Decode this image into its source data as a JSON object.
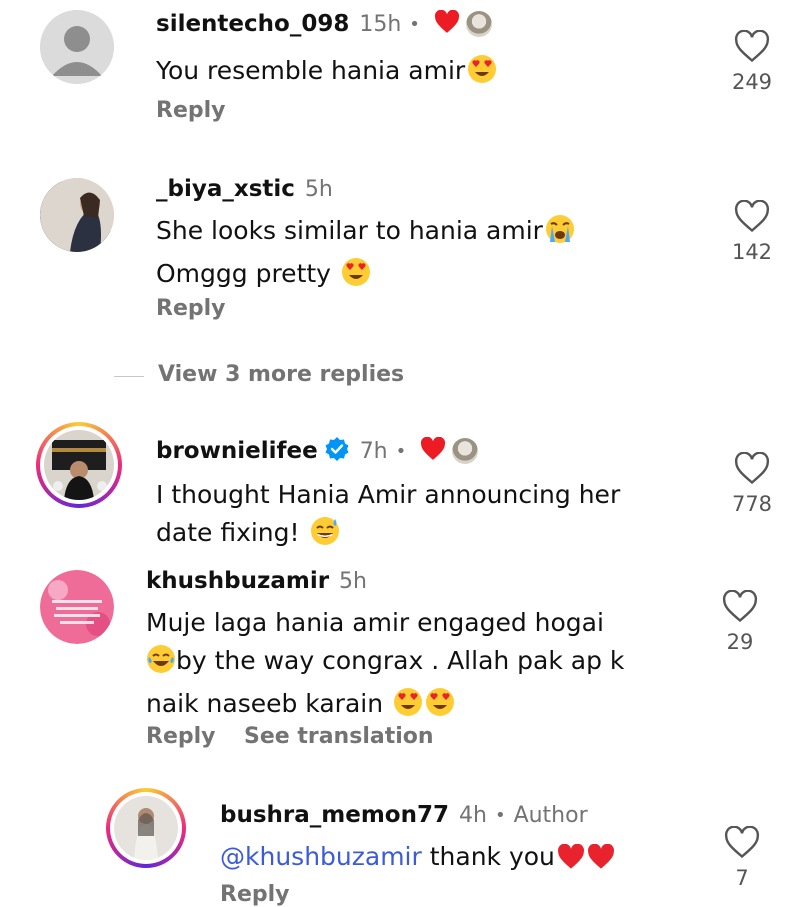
{
  "comments": [
    {
      "username": "silentecho_098",
      "time": "15h",
      "text_lines": [
        "You resemble hania amir"
      ],
      "reply": "Reply",
      "likes": "249",
      "creator_liked": true
    },
    {
      "username": "_biya_xstic",
      "time": "5h",
      "text_lines": [
        "She looks similar to hania amir",
        "Omggg pretty"
      ],
      "reply": "Reply",
      "likes": "142"
    },
    {
      "username": "brownielifee",
      "time": "7h",
      "text_lines": [
        "I thought Hania Amir announcing her",
        "date fixing!"
      ],
      "likes": "778",
      "verified": true,
      "creator_liked": true
    },
    {
      "username": "khushbuzamir",
      "time": "5h",
      "text_lines": [
        "Muje laga hania amir engaged hogai",
        "by the way congrax . Allah pak ap k",
        "naik naseeb karain"
      ],
      "reply": "Reply",
      "see_translation": "See translation",
      "likes": "29"
    },
    {
      "username": "bushra_memon77",
      "time": "4h",
      "badge": "Author",
      "mention": "@khushbuzamir",
      "text": " thank you",
      "reply": "Reply",
      "likes": "7"
    }
  ],
  "view_more": "View 3 more replies",
  "separator": "•",
  "icons": {
    "like": "heart-outline-icon",
    "creator_like": "red-heart-icon",
    "verified": "verified-badge-icon"
  },
  "colors": {
    "heart_red": "#ed1c24",
    "verified_blue": "#0095f6",
    "muted": "#737373",
    "mention": "#3b5bdb"
  }
}
